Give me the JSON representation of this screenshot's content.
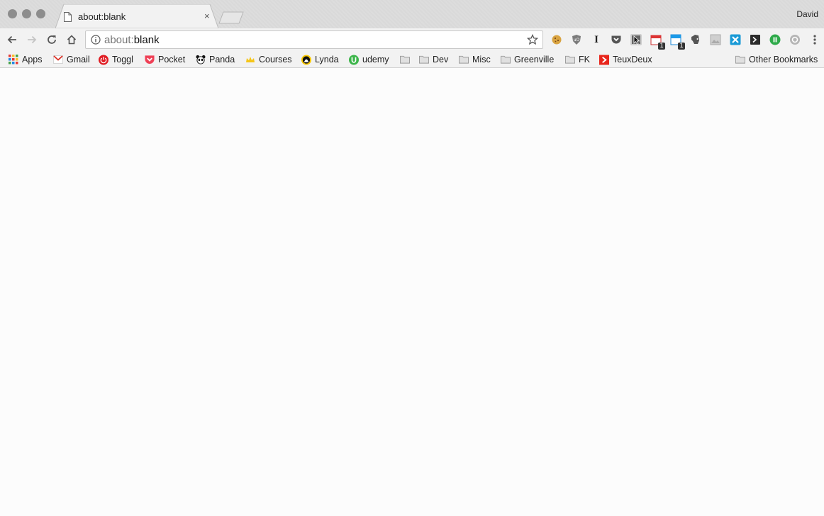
{
  "window": {
    "profile_name": "David"
  },
  "tab": {
    "title": "about:blank",
    "close_glyph": "×"
  },
  "toolbar": {
    "url_scheme": "about:",
    "url_rest": "blank",
    "extensions": [
      {
        "icon": "cookie-icon"
      },
      {
        "icon": "shield-icon"
      },
      {
        "icon": "instapaper-icon",
        "glyph": "I"
      },
      {
        "icon": "pocket-icon"
      },
      {
        "icon": "cursor-extension-icon"
      },
      {
        "icon": "calendar-icon",
        "badge": "1"
      },
      {
        "icon": "window-icon",
        "badge": "1"
      },
      {
        "icon": "evernote-icon"
      },
      {
        "icon": "image-extension-icon"
      },
      {
        "icon": "x-extension-icon"
      },
      {
        "icon": "prompt-icon"
      },
      {
        "icon": "power-icon"
      },
      {
        "icon": "circle-extension-icon"
      }
    ]
  },
  "bookmarks": {
    "items": [
      {
        "label": "Apps",
        "icon": "apps-grid-icon"
      },
      {
        "label": "Gmail",
        "icon": "gmail-icon"
      },
      {
        "label": "Toggl",
        "icon": "toggl-icon"
      },
      {
        "label": "Pocket",
        "icon": "pocket-icon"
      },
      {
        "label": "Panda",
        "icon": "panda-icon"
      },
      {
        "label": "Courses",
        "icon": "crown-icon"
      },
      {
        "label": "Lynda",
        "icon": "lynda-icon"
      },
      {
        "label": "udemy",
        "icon": "udemy-icon"
      },
      {
        "label": "",
        "icon": "folder-icon"
      },
      {
        "label": "Dev",
        "icon": "folder-icon"
      },
      {
        "label": "Misc",
        "icon": "folder-icon"
      },
      {
        "label": "Greenville",
        "icon": "folder-icon"
      },
      {
        "label": "FK",
        "icon": "folder-icon"
      },
      {
        "label": "TeuxDeux",
        "icon": "teuxdeux-icon"
      }
    ],
    "other": "Other Bookmarks"
  },
  "colors": {
    "toggl": "#e01b22",
    "pocket": "#ef4056",
    "udemy": "#3cb54a",
    "teuxdeux": "#e8261c",
    "folder": "#9a9a9a"
  }
}
